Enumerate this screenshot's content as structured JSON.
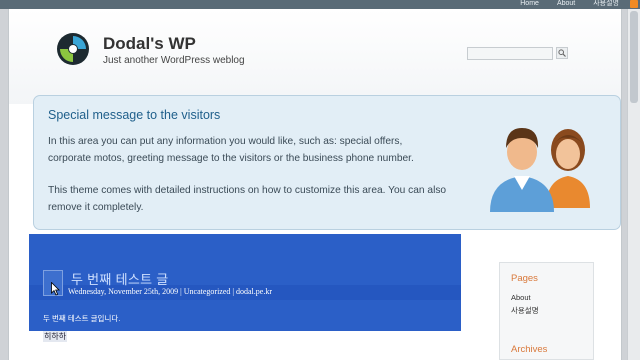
{
  "topnav": {
    "items": [
      "Home",
      "About",
      "사용설명"
    ]
  },
  "header": {
    "title": "Dodal's WP",
    "tagline": "Just another WordPress weblog",
    "search": {
      "value": "",
      "placeholder": ""
    }
  },
  "message": {
    "title": "Special message to the visitors",
    "paragraph1": "In this area you can put any information you would like, such as: special offers, corporate motos, greeting message to the visitors or the business phone number.",
    "paragraph2": "This theme comes with detailed instructions on how to customize this area. You can also remove it completely."
  },
  "post": {
    "title": "두 번째 테스트 글",
    "meta": "Wednesday, November 25th, 2009 | Uncategorized | dodal.pe.kr",
    "body": "두 번째 테스트 글입니다.",
    "extra": "히하하"
  },
  "sidebar": {
    "pages_title": "Pages",
    "pages": [
      "About",
      "사용설명"
    ],
    "archives_title": "Archives"
  },
  "colors": {
    "accent": "#1f5f8b",
    "selection": "#2b5fc7",
    "sidebar_heading": "#d9793b",
    "topbar": "#5a6b77"
  }
}
